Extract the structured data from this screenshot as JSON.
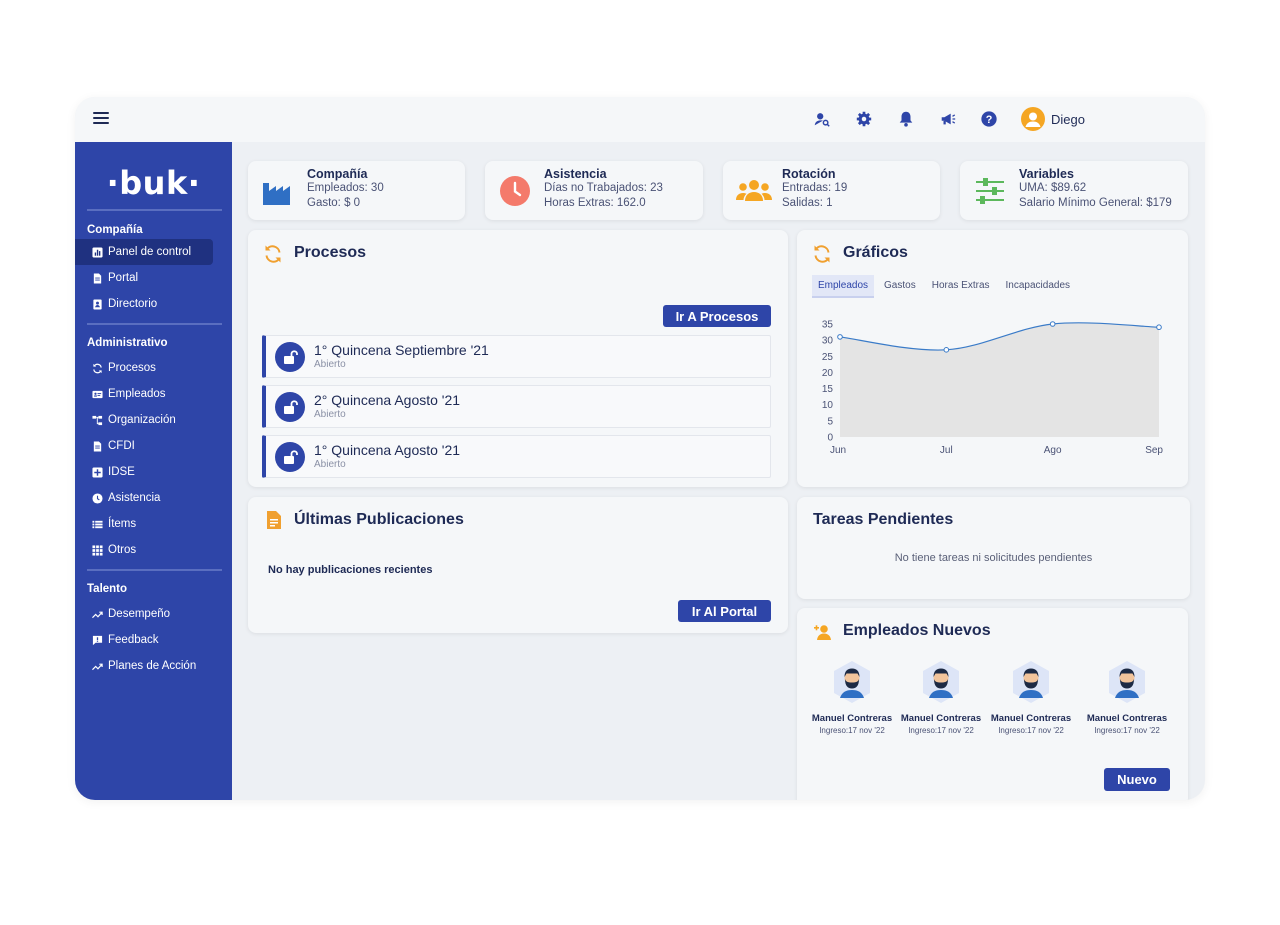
{
  "topbar": {
    "icons": [
      "user-search-icon",
      "gear-icon",
      "bell-icon",
      "megaphone-icon",
      "help-icon"
    ],
    "user_name": "Diego"
  },
  "sidebar": {
    "logo": "·buk·",
    "sections": [
      {
        "title": "Compañía",
        "items": [
          {
            "label": "Panel de control",
            "icon": "chart-icon",
            "active": true
          },
          {
            "label": "Portal",
            "icon": "document-icon"
          },
          {
            "label": "Directorio",
            "icon": "contact-book-icon"
          }
        ]
      },
      {
        "title": "Administrativo",
        "items": [
          {
            "label": "Procesos",
            "icon": "refresh-icon"
          },
          {
            "label": "Empleados",
            "icon": "id-card-icon"
          },
          {
            "label": "Organización",
            "icon": "org-chart-icon"
          },
          {
            "label": "CFDI",
            "icon": "document-icon"
          },
          {
            "label": "IDSE",
            "icon": "plus-box-icon"
          },
          {
            "label": "Asistencia",
            "icon": "clock-icon"
          },
          {
            "label": "Ítems",
            "icon": "list-icon"
          },
          {
            "label": "Otros",
            "icon": "grid-icon"
          }
        ]
      },
      {
        "title": "Talento",
        "items": [
          {
            "label": "Desempeño",
            "icon": "trend-icon"
          },
          {
            "label": "Feedback",
            "icon": "feedback-icon"
          },
          {
            "label": "Planes de Acción",
            "icon": "trend-icon"
          }
        ]
      }
    ]
  },
  "kpis": [
    {
      "title": "Compañía",
      "line1": "Empleados: 30",
      "line2": "Gasto: $ 0",
      "icon": "factory-icon",
      "color": "#2f6fc4"
    },
    {
      "title": "Asistencia",
      "line1": "Días no Trabajados: 23",
      "line2": "Horas Extras: 162.0",
      "icon": "clock-icon",
      "color": "#f47a6b"
    },
    {
      "title": "Rotación",
      "line1": "Entradas: 19",
      "line2": "Salidas: 1",
      "icon": "people-icon",
      "color": "#f5a623"
    },
    {
      "title": "Variables",
      "line1": "UMA: $89.62",
      "line2": "Salario Mínimo General: $179",
      "icon": "sliders-icon",
      "color": "#5cb85c"
    }
  ],
  "procesos": {
    "title": "Procesos",
    "button": "Ir A Procesos",
    "items": [
      {
        "name": "1° Quincena Septiembre '21",
        "status": "Abierto"
      },
      {
        "name": "2° Quincena Agosto '21",
        "status": "Abierto"
      },
      {
        "name": "1° Quincena Agosto '21",
        "status": "Abierto"
      }
    ]
  },
  "graficos": {
    "title": "Gráficos",
    "tabs": [
      "Empleados",
      "Gastos",
      "Horas Extras",
      "Incapacidades"
    ],
    "active_tab": 0
  },
  "chart_data": {
    "type": "area",
    "categories": [
      "Jun",
      "Jul",
      "Ago",
      "Sep"
    ],
    "values": [
      31,
      27,
      35,
      34
    ],
    "ylim": [
      0,
      35
    ],
    "yticks": [
      0,
      5,
      10,
      15,
      20,
      25,
      30,
      35
    ],
    "title": "",
    "xlabel": "",
    "ylabel": "",
    "grid": false,
    "colors": {
      "line": "#3a7bc8",
      "fill": "#e4e4e4"
    }
  },
  "publicaciones": {
    "title": "Últimas Publicaciones",
    "empty": "No hay publicaciones recientes",
    "button": "Ir Al Portal"
  },
  "tareas": {
    "title": "Tareas Pendientes",
    "empty": "No tiene tareas ni solicitudes pendientes"
  },
  "empleados_nuevos": {
    "title": "Empleados Nuevos",
    "button": "Nuevo",
    "items": [
      {
        "name": "Manuel Contreras",
        "date": "Ingreso:17 nov '22"
      },
      {
        "name": "Manuel Contreras",
        "date": "Ingreso:17 nov '22"
      },
      {
        "name": "Manuel Contreras",
        "date": "Ingreso:17 nov '22"
      },
      {
        "name": "Manuel Contreras",
        "date": "Ingreso:17 nov '22"
      }
    ]
  }
}
